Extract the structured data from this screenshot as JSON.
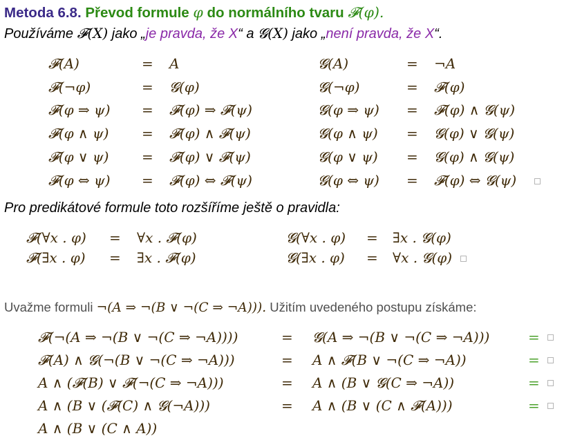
{
  "title": {
    "prefix": "Metoda 6.8.",
    "rest_a": "Převod formule",
    "phi": "φ",
    "rest_b": "do normálního tvaru",
    "F_phi": "𝓕(φ)."
  },
  "intro": {
    "t1": "Používáme",
    "FX": "𝓕(X)",
    "t2": "jako „",
    "p1": "je pravda, že X",
    "t3": "“ a",
    "GX": "𝓖(X)",
    "t4": "jako „",
    "p2": "není pravda, že X",
    "t5": "“."
  },
  "rules": [
    {
      "l1": "𝓕(A)",
      "r1": "A",
      "l2": "𝓖(A)",
      "r2": "¬A"
    },
    {
      "l1": "𝓕(¬φ)",
      "r1": "𝓖(φ)",
      "l2": "𝓖(¬φ)",
      "r2": "𝓕(φ)"
    },
    {
      "l1": "𝓕(φ ⇒ ψ)",
      "r1": "𝓕(φ) ⇒ 𝓕(ψ)",
      "l2": "𝓖(φ ⇒ ψ)",
      "r2": "𝓕(φ) ∧ 𝓖(ψ)"
    },
    {
      "l1": "𝓕(φ ∧ ψ)",
      "r1": "𝓕(φ) ∧ 𝓕(ψ)",
      "l2": "𝓖(φ ∧ ψ)",
      "r2": "𝓖(φ) ∨ 𝓖(ψ)"
    },
    {
      "l1": "𝓕(φ ∨ ψ)",
      "r1": "𝓕(φ) ∨ 𝓕(ψ)",
      "l2": "𝓖(φ ∨ ψ)",
      "r2": "𝓖(φ) ∧ 𝓖(ψ)"
    },
    {
      "l1": "𝓕(φ ⇔ ψ)",
      "r1": "𝓕(φ) ⇔ 𝓕(ψ)",
      "l2": "𝓖(φ ⇔ ψ)",
      "r2": "𝓕(φ) ⇔ 𝓖(ψ)"
    }
  ],
  "predicate_intro": "Pro predikátové formule toto rozšíříme ještě o pravidla:",
  "predicate_rules": [
    {
      "l1": "𝓕(∀x . φ)",
      "r1": "∀x . 𝓕(φ)",
      "l2": "𝓖(∀x . φ)",
      "r2": "∃x . 𝓖(φ)"
    },
    {
      "l1": "𝓕(∃x . φ)",
      "r1": "∃x . 𝓕(φ)",
      "l2": "𝓖(∃x . φ)",
      "r2": "∀x . 𝓖(φ)"
    }
  ],
  "example_intro": {
    "t1": "Uvažme formuli",
    "formula": "¬(A ⇒ ¬(B ∨ ¬(C ⇒ ¬A))).",
    "t2": "Užitím uvedeného postupu získáme:"
  },
  "steps": [
    {
      "left": "𝓕(¬(A ⇒ ¬(B ∨ ¬(C ⇒ ¬A))))",
      "right": "𝓖(A ⇒ ¬(B ∨ ¬(C ⇒ ¬A)))"
    },
    {
      "left": "𝓕(A) ∧ 𝓖(¬(B ∨ ¬(C ⇒ ¬A)))",
      "right": "A ∧ 𝓕(B ∨ ¬(C ⇒ ¬A))"
    },
    {
      "left": "A ∧ (𝓕(B) ∨ 𝓕(¬(C ⇒ ¬A)))",
      "right": "A ∧ (B ∨ 𝓖(C ⇒ ¬A))"
    },
    {
      "left": "A ∧ (B ∨ (𝓕(C) ∧ 𝓖(¬A)))",
      "right": "A ∧ (B ∨ (C ∧ 𝓕(A)))"
    }
  ],
  "final": "A ∧ (B ∨ (C ∧ A))",
  "eq": "=",
  "colors": {
    "title_prefix": "#3b2a88",
    "title_rest": "#2c8a14",
    "italic_purple": "#8a2aa8",
    "math": "#3f2a08",
    "green": "#4aa02a"
  }
}
